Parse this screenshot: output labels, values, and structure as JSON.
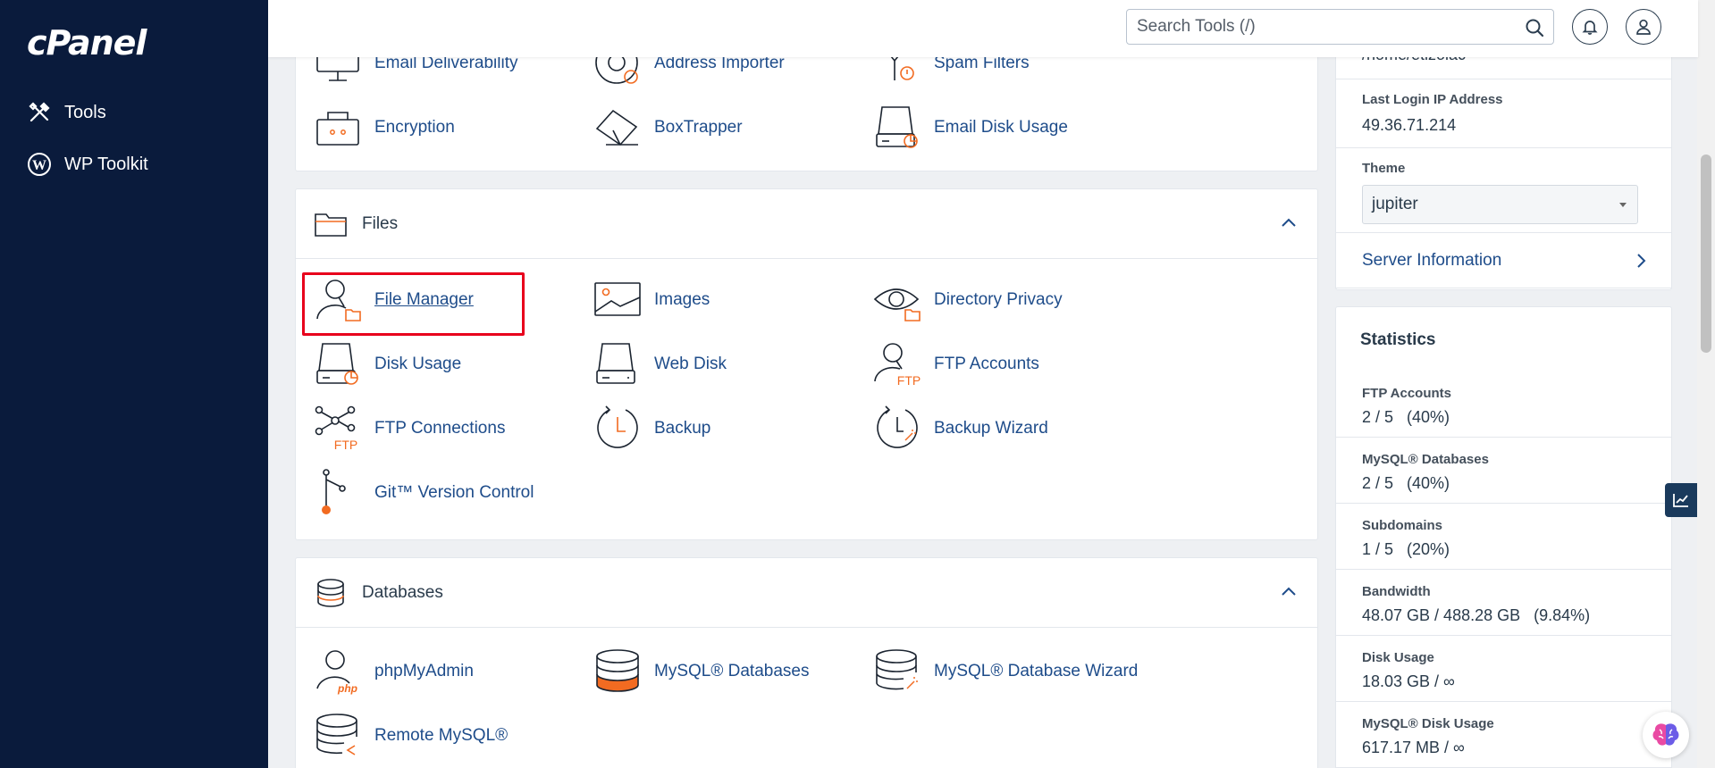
{
  "app": {
    "logo": "cPanel"
  },
  "sidebar": {
    "items": [
      {
        "label": "Tools",
        "icon": "tools-icon"
      },
      {
        "label": "WP Toolkit",
        "icon": "wordpress-icon"
      }
    ]
  },
  "topbar": {
    "search_placeholder": "Search Tools (/)",
    "icons": [
      "search-icon",
      "bell-icon",
      "user-icon"
    ]
  },
  "email_section": {
    "tools": [
      {
        "label": "Email Deliverability",
        "icon": "monitor-icon"
      },
      {
        "label": "Address Importer",
        "icon": "address-importer-icon"
      },
      {
        "label": "Spam Filters",
        "icon": "spam-filter-icon"
      },
      {
        "label": "Encryption",
        "icon": "encryption-icon"
      },
      {
        "label": "BoxTrapper",
        "icon": "boxtrapper-icon"
      },
      {
        "label": "Email Disk Usage",
        "icon": "disk-usage-icon"
      }
    ]
  },
  "files_section": {
    "title": "Files",
    "tools": [
      {
        "label": "File Manager",
        "icon": "file-manager-icon"
      },
      {
        "label": "Images",
        "icon": "image-icon"
      },
      {
        "label": "Directory Privacy",
        "icon": "eye-folder-icon"
      },
      {
        "label": "Disk Usage",
        "icon": "disk-usage-icon"
      },
      {
        "label": "Web Disk",
        "icon": "web-disk-icon"
      },
      {
        "label": "FTP Accounts",
        "icon": "ftp-accounts-icon"
      },
      {
        "label": "FTP Connections",
        "icon": "ftp-connections-icon"
      },
      {
        "label": "Backup",
        "icon": "backup-icon"
      },
      {
        "label": "Backup Wizard",
        "icon": "backup-wizard-icon"
      },
      {
        "label": "Git™ Version Control",
        "icon": "git-icon"
      }
    ]
  },
  "databases_section": {
    "title": "Databases",
    "tools": [
      {
        "label": "phpMyAdmin",
        "icon": "phpmyadmin-icon"
      },
      {
        "label": "MySQL® Databases",
        "icon": "database-icon"
      },
      {
        "label": "MySQL® Database Wizard",
        "icon": "database-wizard-icon"
      },
      {
        "label": "Remote MySQL®",
        "icon": "remote-mysql-icon"
      }
    ]
  },
  "general_info": {
    "home_directory_value": "/home/etizoiac",
    "last_login_label": "Last Login IP Address",
    "last_login_value": "49.36.71.214",
    "theme_label": "Theme",
    "theme_value": "jupiter",
    "server_info_label": "Server Information"
  },
  "statistics": {
    "title": "Statistics",
    "rows": [
      {
        "label": "FTP Accounts",
        "value": "2 / 5   (40%)"
      },
      {
        "label": "MySQL® Databases",
        "value": "2 / 5   (40%)"
      },
      {
        "label": "Subdomains",
        "value": "1 / 5   (20%)"
      },
      {
        "label": "Bandwidth",
        "value": "48.07 GB / 488.28 GB   (9.84%)"
      },
      {
        "label": "Disk Usage",
        "value": "18.03 GB / ∞"
      },
      {
        "label": "MySQL® Disk Usage",
        "value": "617.17 MB / ∞"
      }
    ]
  },
  "colors": {
    "sidebar": "#0a1b3c",
    "link": "#1e4c8a",
    "accent_orange": "#f26b21",
    "highlight": "#e8001c"
  }
}
